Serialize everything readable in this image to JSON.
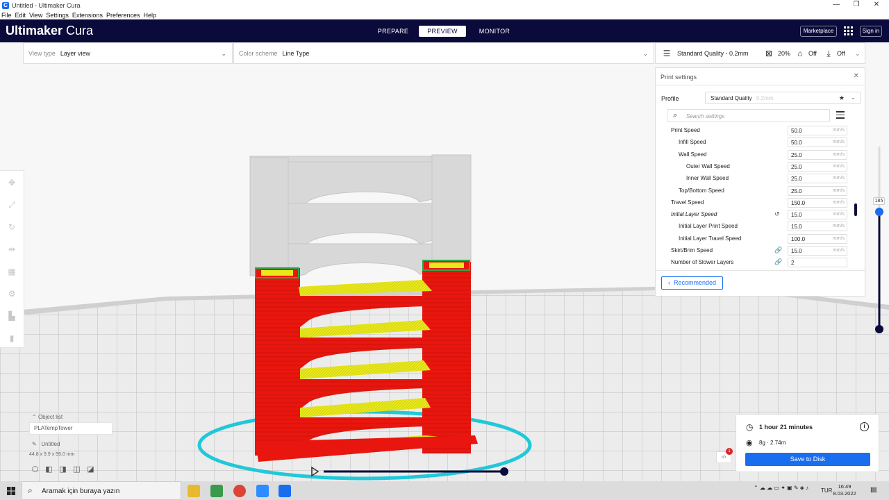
{
  "window": {
    "title": "Untitled - Ultimaker Cura",
    "controls": [
      "—",
      "❐",
      "✕"
    ]
  },
  "menu": [
    "File",
    "Edit",
    "View",
    "Settings",
    "Extensions",
    "Preferences",
    "Help"
  ],
  "header": {
    "brand_bold": "Ultimaker",
    "brand_light": " Cura",
    "tabs": [
      {
        "label": "PREPARE",
        "active": false
      },
      {
        "label": "PREVIEW",
        "active": true
      },
      {
        "label": "MONITOR",
        "active": false
      }
    ],
    "marketplace": "Marketplace",
    "signin": "Sign in"
  },
  "viewbar": {
    "view_type_label": "View type",
    "view_type_value": "Layer view",
    "color_scheme_label": "Color scheme",
    "color_scheme_value": "Line Type"
  },
  "printbar": {
    "profile": "Standard Quality - 0.2mm",
    "infill": "20%",
    "support": "Off",
    "adhesion": "Off"
  },
  "print_settings": {
    "title": "Print settings",
    "profile_label": "Profile",
    "profile_name": "Standard Quality",
    "profile_sub": "0.2mm",
    "search_placeholder": "Search settings",
    "rows": [
      {
        "label": "Print Speed",
        "value": "50.0",
        "unit": "mm/s",
        "indent": 0,
        "italic": false,
        "icon": ""
      },
      {
        "label": "Infill Speed",
        "value": "50.0",
        "unit": "mm/s",
        "indent": 1,
        "italic": false,
        "icon": ""
      },
      {
        "label": "Wall Speed",
        "value": "25.0",
        "unit": "mm/s",
        "indent": 1,
        "italic": false,
        "icon": ""
      },
      {
        "label": "Outer Wall Speed",
        "value": "25.0",
        "unit": "mm/s",
        "indent": 2,
        "italic": false,
        "icon": ""
      },
      {
        "label": "Inner Wall Speed",
        "value": "25.0",
        "unit": "mm/s",
        "indent": 2,
        "italic": false,
        "icon": ""
      },
      {
        "label": "Top/Bottom Speed",
        "value": "25.0",
        "unit": "mm/s",
        "indent": 1,
        "italic": false,
        "icon": ""
      },
      {
        "label": "Travel Speed",
        "value": "150.0",
        "unit": "mm/s",
        "indent": 0,
        "italic": false,
        "icon": ""
      },
      {
        "label": "Initial Layer Speed",
        "value": "15.0",
        "unit": "mm/s",
        "indent": 0,
        "italic": true,
        "icon": "↺"
      },
      {
        "label": "Initial Layer Print Speed",
        "value": "15.0",
        "unit": "mm/s",
        "indent": 1,
        "italic": false,
        "icon": ""
      },
      {
        "label": "Initial Layer Travel Speed",
        "value": "100.0",
        "unit": "mm/s",
        "indent": 1,
        "italic": false,
        "icon": ""
      },
      {
        "label": "Skirt/Brim Speed",
        "value": "15.0",
        "unit": "mm/s",
        "indent": 0,
        "italic": false,
        "icon": "🔗"
      },
      {
        "label": "Number of Slower Layers",
        "value": "2",
        "unit": "",
        "indent": 0,
        "italic": false,
        "icon": "🔗"
      }
    ],
    "recommended": "Recommended"
  },
  "object_list": {
    "title": "Object list",
    "item": "PLATempTower",
    "name": "Untitled",
    "dimensions": "44.8 x 9.9 x 59.0 mm"
  },
  "job": {
    "time": "1 hour 21 minutes",
    "material": "8g · 2.74m",
    "save": "Save to Disk",
    "badge": "1",
    "code_icon": "‹/›"
  },
  "layer_slider": {
    "value": "185",
    "level": 0.6
  },
  "taskbar": {
    "search_text": "Aramak için buraya yazın",
    "lang": "TUR",
    "time": "16:49",
    "date": "8.03.2022"
  },
  "colors": {
    "accent": "#196ef0",
    "header": "#0a0b3a",
    "wall": "#e8160e",
    "infill": "#e8e81a",
    "skirt": "#20c8d8"
  }
}
